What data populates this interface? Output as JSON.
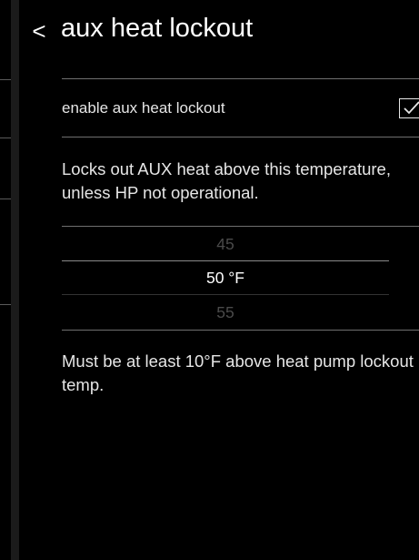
{
  "header": {
    "back_glyph": "<",
    "title": "aux heat lockout"
  },
  "enable_row": {
    "label": "enable aux heat lockout",
    "checked": true
  },
  "description": "Locks out AUX heat above this temperature, unless HP not operational.",
  "picker": {
    "prev": "45",
    "selected": "50 °F",
    "next": "55"
  },
  "note": "Must be at least 10°F above heat pump lockout temp."
}
